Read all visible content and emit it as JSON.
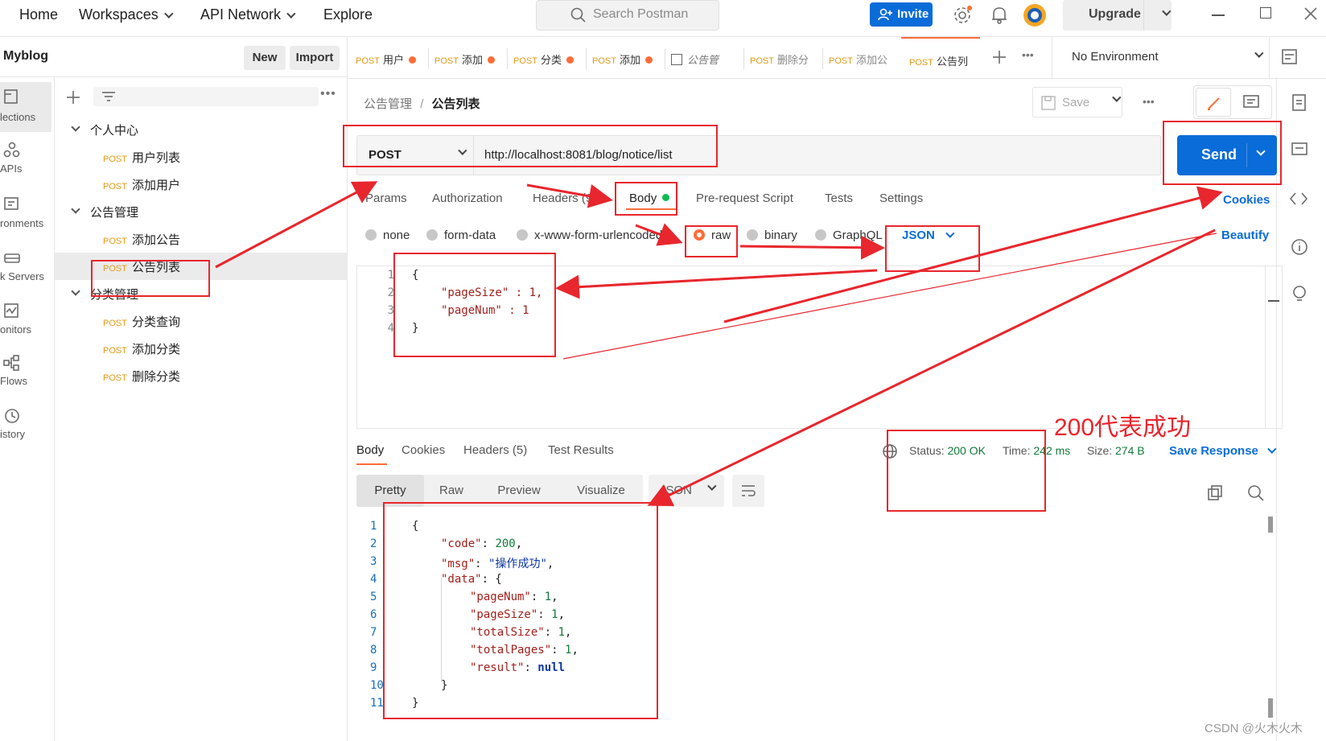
{
  "topbar": {
    "nav": [
      {
        "label": "Home",
        "caret": false
      },
      {
        "label": "Workspaces",
        "caret": true
      },
      {
        "label": "API Network",
        "caret": true
      },
      {
        "label": "Explore",
        "caret": false
      }
    ],
    "search_placeholder": "Search Postman",
    "invite_label": "Invite",
    "upgrade_label": "Upgrade"
  },
  "workspace": {
    "name": "Myblog",
    "new_label": "New",
    "import_label": "Import"
  },
  "rail": [
    {
      "label": "lections",
      "icon": "collections-icon"
    },
    {
      "label": "APIs",
      "icon": "apis-icon"
    },
    {
      "label": "ronments",
      "icon": "environments-icon"
    },
    {
      "label": "k Servers",
      "icon": "mock-servers-icon"
    },
    {
      "label": "onitors",
      "icon": "monitors-icon"
    },
    {
      "label": "Flows",
      "icon": "flows-icon"
    },
    {
      "label": "istory",
      "icon": "history-icon"
    }
  ],
  "tree": [
    {
      "type": "folder",
      "label": "个人中心"
    },
    {
      "type": "request",
      "method": "POST",
      "label": "用户列表"
    },
    {
      "type": "request",
      "method": "POST",
      "label": "添加用户"
    },
    {
      "type": "folder",
      "label": "公告管理"
    },
    {
      "type": "request",
      "method": "POST",
      "label": "添加公告"
    },
    {
      "type": "request",
      "method": "POST",
      "label": "公告列表",
      "selected": true
    },
    {
      "type": "folder",
      "label": "分类管理"
    },
    {
      "type": "request",
      "method": "POST",
      "label": "分类查询"
    },
    {
      "type": "request",
      "method": "POST",
      "label": "添加分类"
    },
    {
      "type": "request",
      "method": "POST",
      "label": "删除分类"
    }
  ],
  "tabs": [
    {
      "method": "POST",
      "label": "用户",
      "dirty": true
    },
    {
      "method": "POST",
      "label": "添加",
      "dirty": true
    },
    {
      "method": "POST",
      "label": "分类",
      "dirty": true
    },
    {
      "method": "POST",
      "label": "添加",
      "dirty": true
    },
    {
      "method": "",
      "label": "公告管",
      "dirty": false
    },
    {
      "method": "POST",
      "label": "删除分",
      "dirty": false
    },
    {
      "method": "POST",
      "label": "添加公",
      "dirty": false
    },
    {
      "method": "POST",
      "label": "公告列",
      "dirty": false,
      "active": true
    }
  ],
  "environment": "No Environment",
  "breadcrumb": {
    "parent": "公告管理",
    "sep": "/",
    "current": "公告列表"
  },
  "save_label": "Save",
  "request": {
    "method": "POST",
    "url": "http://localhost:8081/blog/notice/list",
    "send_label": "Send"
  },
  "req_tabs": [
    {
      "label": "Params"
    },
    {
      "label": "Authorization"
    },
    {
      "label": "Headers (9)"
    },
    {
      "label": "Body"
    },
    {
      "label": "Pre-request Script"
    },
    {
      "label": "Tests"
    },
    {
      "label": "Settings"
    }
  ],
  "cookies_label": "Cookies",
  "beautify_label": "Beautify",
  "body_types": [
    "none",
    "form-data",
    "x-www-form-urlencoded",
    "raw",
    "binary",
    "GraphQL"
  ],
  "body_format": "JSON",
  "body_lines": [
    {
      "n": "1",
      "text": "{"
    },
    {
      "n": "2",
      "text": "\"pageSize\" : 1,"
    },
    {
      "n": "3",
      "text": "\"pageNum\" : 1"
    },
    {
      "n": "4",
      "text": "}"
    }
  ],
  "resp_tabs": [
    {
      "label": "Body"
    },
    {
      "label": "Cookies"
    },
    {
      "label": "Headers (5)"
    },
    {
      "label": "Test Results"
    }
  ],
  "resp_status": {
    "status_label": "Status:",
    "status": "200 OK",
    "time_label": "Time:",
    "time": "242 ms",
    "size_label": "Size:",
    "size": "274 B",
    "save_response": "Save Response"
  },
  "resp_views": [
    "Pretty",
    "Raw",
    "Preview",
    "Visualize"
  ],
  "resp_format": "JSON",
  "resp_lines": [
    {
      "n": "1",
      "text": "{"
    },
    {
      "n": "2",
      "text": "\"code\": 200,"
    },
    {
      "n": "3",
      "text": "\"msg\": \"操作成功\","
    },
    {
      "n": "4",
      "text": "\"data\": {"
    },
    {
      "n": "5",
      "text": "\"pageNum\": 1,"
    },
    {
      "n": "6",
      "text": "\"pageSize\": 1,"
    },
    {
      "n": "7",
      "text": "\"totalSize\": 1,"
    },
    {
      "n": "8",
      "text": "\"totalPages\": 1,"
    },
    {
      "n": "9",
      "text": "\"result\": null"
    },
    {
      "n": "10",
      "text": "}"
    },
    {
      "n": "11",
      "text": "}"
    }
  ],
  "annotation_text": "200代表成功",
  "watermark": "CSDN @火木火木",
  "colors": {
    "accent": "#0a6cd8",
    "postman_orange": "#ff6c37",
    "method_post": "#e39a17",
    "annotation_red": "#e8262d",
    "status_ok": "#117b39"
  }
}
